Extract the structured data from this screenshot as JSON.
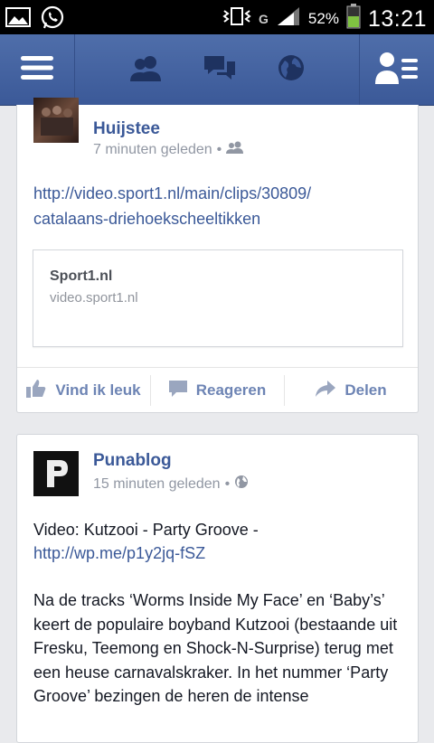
{
  "status_bar": {
    "battery_percent": "52%",
    "time": "13:21",
    "network_indicator": "G",
    "icons": [
      "image-icon",
      "whatsapp-icon",
      "vibrate-icon",
      "signal-icon",
      "battery-icon"
    ]
  },
  "top_bar": {
    "icons": [
      "menu-icon",
      "friend-requests-icon",
      "messages-icon",
      "notifications-globe-icon",
      "friends-sidebar-icon"
    ],
    "accent": "#3b5998"
  },
  "post1": {
    "author": "Huijstee",
    "time": "7 minuten geleden",
    "privacy_icon": "friends-icon",
    "link_line1": "http://video.sport1.nl/main/clips/30809/",
    "link_line2": "catalaans-driehoekscheeltikken",
    "preview_title": "Sport1.nl",
    "preview_url": "video.sport1.nl"
  },
  "actions": {
    "like": "Vind ik leuk",
    "comment": "Reageren",
    "share": "Delen"
  },
  "post2": {
    "author": "Punablog",
    "time": "15 minuten geleden",
    "privacy_icon": "globe-icon",
    "text_intro": "Video: Kutzooi - Party Groove - ",
    "link": "http://wp.me/p1y2jq-fSZ",
    "body": "Na de tracks ‘Worms Inside My Face’ en ‘Baby’s’ keert de populaire boyband Kutzooi (bestaande uit Fresku, Teemong en Shock-N-Surprise) terug met een heuse carnavalskraker. In het nummer ‘Party Groove’ bezingen de heren de intense"
  }
}
